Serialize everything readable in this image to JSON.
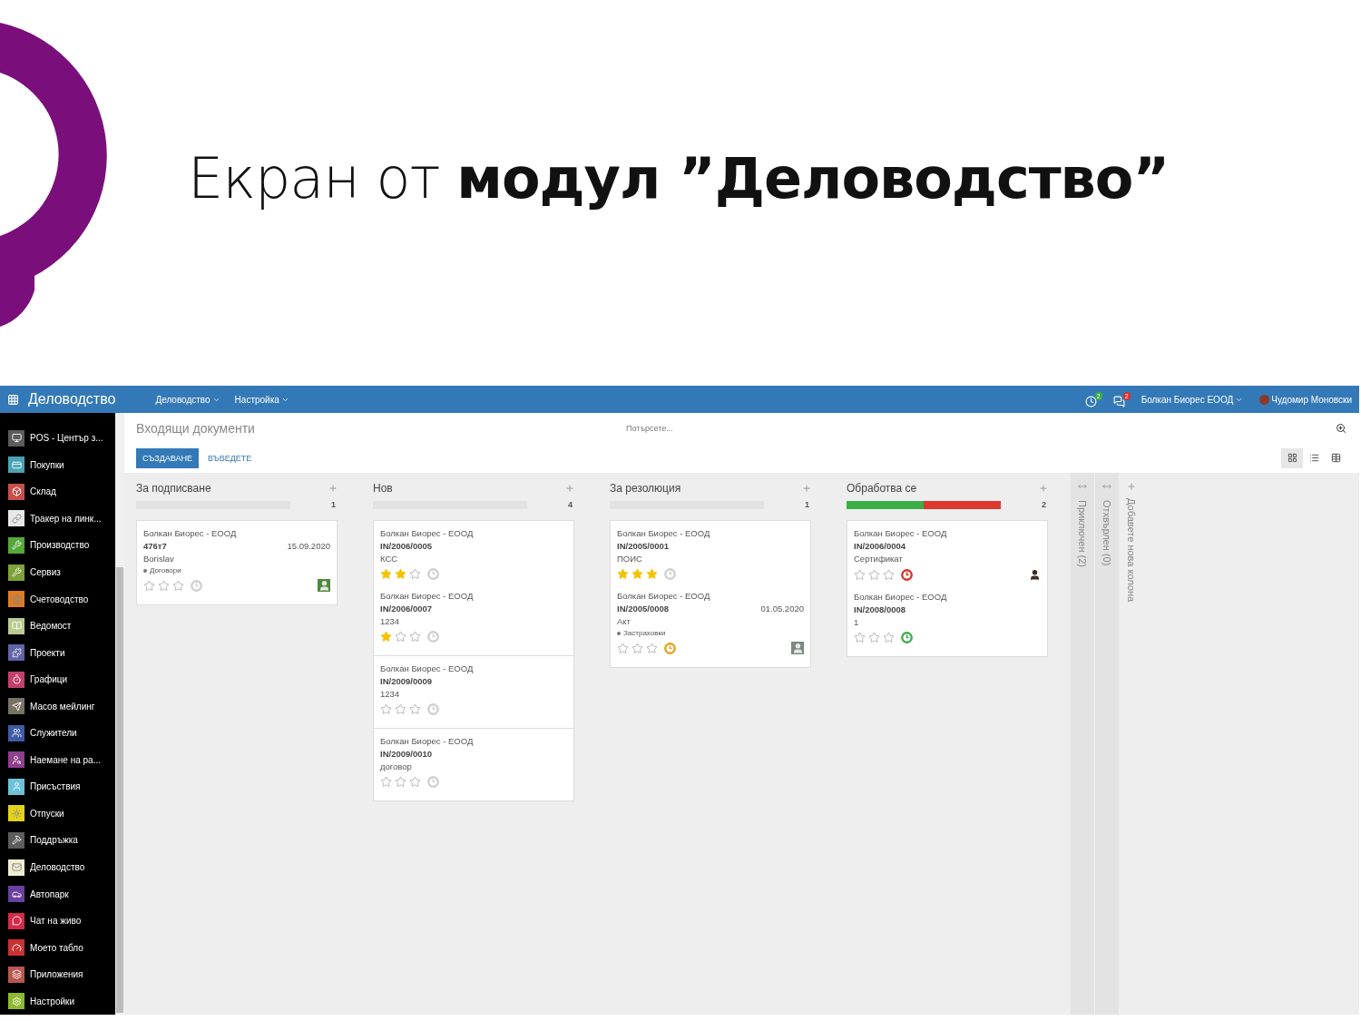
{
  "slide": {
    "title": "Екран от **модул ”Деловодство”**"
  },
  "navbar": {
    "brand": "Деловодство",
    "menus": [
      "Деловодство",
      "Настройка"
    ],
    "activity_badge": "2",
    "messages_badge": "2",
    "company": "Болкан Биорес ЕООД",
    "user": "Чудомир Моновски"
  },
  "sidebar": {
    "items": [
      {
        "label": "POS - Център з...",
        "color": "#5b5b5b"
      },
      {
        "label": "Покупки",
        "color": "#4aa3b5"
      },
      {
        "label": "Склад",
        "color": "#c8504a"
      },
      {
        "label": "Тракер на линк...",
        "color": "#e8e8e8"
      },
      {
        "label": "Производство",
        "color": "#55a83a"
      },
      {
        "label": "Сервиз",
        "color": "#7ea23a"
      },
      {
        "label": "Счетоводство",
        "color": "#e07b22"
      },
      {
        "label": "Ведомост",
        "color": "#b9cc8e"
      },
      {
        "label": "Проекти",
        "color": "#6163a8"
      },
      {
        "label": "Графици",
        "color": "#c2406b"
      },
      {
        "label": "Масов мейлинг",
        "color": "#7a7263"
      },
      {
        "label": "Служители",
        "color": "#3f5ba6"
      },
      {
        "label": "Наемане на ра...",
        "color": "#8e3f8e"
      },
      {
        "label": "Присъствия",
        "color": "#6cc2d8"
      },
      {
        "label": "Отпуски",
        "color": "#e2d21c"
      },
      {
        "label": "Поддръжка",
        "color": "#5c5c5c"
      },
      {
        "label": "Деловодство",
        "color": "#f1edd2"
      },
      {
        "label": "Автопарк",
        "color": "#6b409e"
      },
      {
        "label": "Чат на живо",
        "color": "#d42b4b"
      },
      {
        "label": "Моето табло",
        "color": "#c93232"
      },
      {
        "label": "Приложения",
        "color": "#b8574f"
      },
      {
        "label": "Настройки",
        "color": "#8cb92e"
      }
    ]
  },
  "control_panel": {
    "breadcrumb": "Входящи документи",
    "search": {
      "placeholder": "Потърсете..."
    },
    "buttons": [
      "СЪЗДАВАНЕ",
      "ВЪВЕДЕТЕ"
    ],
    "views": [
      {
        "kind": "kanban",
        "selected": true
      },
      {
        "kind": "list",
        "selected": false
      },
      {
        "kind": "table",
        "selected": false
      }
    ]
  },
  "columns": [
    {
      "title": "За подписване",
      "count": "1",
      "progress": {
        "level": 0
      },
      "cards": [
        [
          {
            "company": "Болкан Биорес - ЕООД",
            "ref": "476т7",
            "date": "15.09.2020",
            "subject": "Borislav",
            "tag": "Договори",
            "stars": 0,
            "clock": {
              "color": "#cfcfcf"
            },
            "avatar": {
              "kind": "default"
            }
          }
        ]
      ]
    },
    {
      "title": "Нов",
      "count": "4",
      "progress": {
        "level": 0
      },
      "cards": [
        [
          {
            "company": "Болкан Биорес - ЕООД",
            "ref": "IN/2006/0005",
            "subject": "КСС",
            "stars": 2,
            "clock": {
              "color": "#cfcfcf"
            }
          },
          {
            "company": "Болкан Биорес - ЕООД",
            "ref": "IN/2006/0007",
            "subject": "1234",
            "stars": 1,
            "clock": {
              "color": "#cfcfcf"
            }
          }
        ],
        [
          {
            "company": "Болкан Биорес - ЕООД",
            "ref": "IN/2009/0009",
            "subject": "1234",
            "stars": 0,
            "clock": {
              "color": "#cfcfcf"
            }
          }
        ],
        [
          {
            "company": "Болкан Биорес - ЕООД",
            "ref": "IN/2009/0010",
            "subject": "договор",
            "stars": 0,
            "clock": {
              "color": "#cfcfcf"
            }
          }
        ]
      ]
    },
    {
      "title": "За резолюция",
      "count": "1",
      "progress": {
        "level": 0
      },
      "cards": [
        [
          {
            "company": "Болкан Биорес - ЕООД",
            "ref": "IN/2005/0001",
            "subject": "ПОИС",
            "stars": 3,
            "clock": {
              "color": "#cfcfcf"
            }
          },
          {
            "company": "Болкан Биорес - ЕООД",
            "ref": "IN/2005/0008",
            "date": "01.05.2020",
            "subject": "Акт",
            "tag": "Застраховки",
            "stars": 0,
            "clock": {
              "color": "#e8a21a"
            },
            "avatar": {
              "kind": "photo"
            }
          }
        ]
      ]
    },
    {
      "title": "Обработва се",
      "count": "2",
      "progress": {
        "segments": [
          {
            "color": "#3bae49",
            "level": 0.5
          },
          {
            "color": "#dd3a2f",
            "level": 0.5
          }
        ]
      },
      "cards": [
        [
          {
            "company": "Болкан Биорес - ЕООД",
            "ref": "IN/2006/0004",
            "subject": "Сертификат",
            "stars": 0,
            "clock": {
              "color": "#d9312b"
            },
            "avatar": {
              "kind": "figure"
            }
          },
          {
            "company": "Болкан Биорес - ЕООД",
            "ref": "IN/2008/0008",
            "subject": "1",
            "stars": 0,
            "clock": {
              "color": "#3bae49"
            }
          }
        ]
      ]
    }
  ],
  "folded_columns": [
    "Приключен (2)",
    "Отхвърлен (0)"
  ],
  "add_column": "Добавете нова колона"
}
